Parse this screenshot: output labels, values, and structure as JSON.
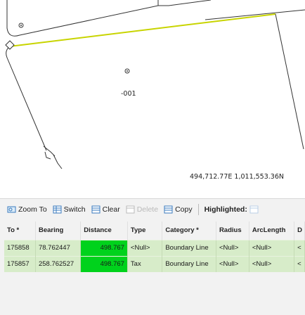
{
  "map": {
    "label_number": "-001",
    "coordinates": "494,712.77E 1,011,553.36N"
  },
  "toolbar": {
    "zoom_to": "Zoom To",
    "switch": "Switch",
    "clear": "Clear",
    "delete": "Delete",
    "copy": "Copy",
    "highlighted": "Highlighted:"
  },
  "table": {
    "columns": [
      "To *",
      "Bearing",
      "Distance",
      "Type",
      "Category *",
      "Radius",
      "ArcLength",
      "D"
    ],
    "rows": [
      [
        "175858",
        "78.762447",
        "498.767",
        "<Null>",
        "Boundary Line",
        "<Null>",
        "<Null>",
        "<"
      ],
      [
        "175857",
        "258.762527",
        "498.767",
        "Tax",
        "Boundary Line",
        "<Null>",
        "<Null>",
        "<"
      ]
    ]
  },
  "colors": {
    "parcel_line": "#c8d400",
    "highlight": "#00d21c",
    "row_selected": "#d7ecc9"
  },
  "icons": [
    "zoom-to-icon",
    "switch-icon",
    "clear-icon",
    "delete-icon",
    "copy-icon",
    "highlighted-icon",
    "point-icon"
  ]
}
